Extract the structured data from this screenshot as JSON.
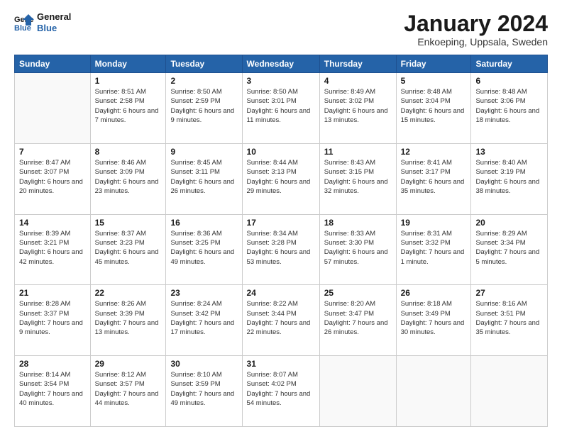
{
  "logo": {
    "line1": "General",
    "line2": "Blue"
  },
  "header": {
    "month_year": "January 2024",
    "location": "Enkoeping, Uppsala, Sweden"
  },
  "days_of_week": [
    "Sunday",
    "Monday",
    "Tuesday",
    "Wednesday",
    "Thursday",
    "Friday",
    "Saturday"
  ],
  "weeks": [
    [
      {
        "day": "",
        "sunrise": "",
        "sunset": "",
        "daylight": "",
        "empty": true
      },
      {
        "day": "1",
        "sunrise": "Sunrise: 8:51 AM",
        "sunset": "Sunset: 2:58 PM",
        "daylight": "Daylight: 6 hours and 7 minutes."
      },
      {
        "day": "2",
        "sunrise": "Sunrise: 8:50 AM",
        "sunset": "Sunset: 2:59 PM",
        "daylight": "Daylight: 6 hours and 9 minutes."
      },
      {
        "day": "3",
        "sunrise": "Sunrise: 8:50 AM",
        "sunset": "Sunset: 3:01 PM",
        "daylight": "Daylight: 6 hours and 11 minutes."
      },
      {
        "day": "4",
        "sunrise": "Sunrise: 8:49 AM",
        "sunset": "Sunset: 3:02 PM",
        "daylight": "Daylight: 6 hours and 13 minutes."
      },
      {
        "day": "5",
        "sunrise": "Sunrise: 8:48 AM",
        "sunset": "Sunset: 3:04 PM",
        "daylight": "Daylight: 6 hours and 15 minutes."
      },
      {
        "day": "6",
        "sunrise": "Sunrise: 8:48 AM",
        "sunset": "Sunset: 3:06 PM",
        "daylight": "Daylight: 6 hours and 18 minutes."
      }
    ],
    [
      {
        "day": "7",
        "sunrise": "Sunrise: 8:47 AM",
        "sunset": "Sunset: 3:07 PM",
        "daylight": "Daylight: 6 hours and 20 minutes."
      },
      {
        "day": "8",
        "sunrise": "Sunrise: 8:46 AM",
        "sunset": "Sunset: 3:09 PM",
        "daylight": "Daylight: 6 hours and 23 minutes."
      },
      {
        "day": "9",
        "sunrise": "Sunrise: 8:45 AM",
        "sunset": "Sunset: 3:11 PM",
        "daylight": "Daylight: 6 hours and 26 minutes."
      },
      {
        "day": "10",
        "sunrise": "Sunrise: 8:44 AM",
        "sunset": "Sunset: 3:13 PM",
        "daylight": "Daylight: 6 hours and 29 minutes."
      },
      {
        "day": "11",
        "sunrise": "Sunrise: 8:43 AM",
        "sunset": "Sunset: 3:15 PM",
        "daylight": "Daylight: 6 hours and 32 minutes."
      },
      {
        "day": "12",
        "sunrise": "Sunrise: 8:41 AM",
        "sunset": "Sunset: 3:17 PM",
        "daylight": "Daylight: 6 hours and 35 minutes."
      },
      {
        "day": "13",
        "sunrise": "Sunrise: 8:40 AM",
        "sunset": "Sunset: 3:19 PM",
        "daylight": "Daylight: 6 hours and 38 minutes."
      }
    ],
    [
      {
        "day": "14",
        "sunrise": "Sunrise: 8:39 AM",
        "sunset": "Sunset: 3:21 PM",
        "daylight": "Daylight: 6 hours and 42 minutes."
      },
      {
        "day": "15",
        "sunrise": "Sunrise: 8:37 AM",
        "sunset": "Sunset: 3:23 PM",
        "daylight": "Daylight: 6 hours and 45 minutes."
      },
      {
        "day": "16",
        "sunrise": "Sunrise: 8:36 AM",
        "sunset": "Sunset: 3:25 PM",
        "daylight": "Daylight: 6 hours and 49 minutes."
      },
      {
        "day": "17",
        "sunrise": "Sunrise: 8:34 AM",
        "sunset": "Sunset: 3:28 PM",
        "daylight": "Daylight: 6 hours and 53 minutes."
      },
      {
        "day": "18",
        "sunrise": "Sunrise: 8:33 AM",
        "sunset": "Sunset: 3:30 PM",
        "daylight": "Daylight: 6 hours and 57 minutes."
      },
      {
        "day": "19",
        "sunrise": "Sunrise: 8:31 AM",
        "sunset": "Sunset: 3:32 PM",
        "daylight": "Daylight: 7 hours and 1 minute."
      },
      {
        "day": "20",
        "sunrise": "Sunrise: 8:29 AM",
        "sunset": "Sunset: 3:34 PM",
        "daylight": "Daylight: 7 hours and 5 minutes."
      }
    ],
    [
      {
        "day": "21",
        "sunrise": "Sunrise: 8:28 AM",
        "sunset": "Sunset: 3:37 PM",
        "daylight": "Daylight: 7 hours and 9 minutes."
      },
      {
        "day": "22",
        "sunrise": "Sunrise: 8:26 AM",
        "sunset": "Sunset: 3:39 PM",
        "daylight": "Daylight: 7 hours and 13 minutes."
      },
      {
        "day": "23",
        "sunrise": "Sunrise: 8:24 AM",
        "sunset": "Sunset: 3:42 PM",
        "daylight": "Daylight: 7 hours and 17 minutes."
      },
      {
        "day": "24",
        "sunrise": "Sunrise: 8:22 AM",
        "sunset": "Sunset: 3:44 PM",
        "daylight": "Daylight: 7 hours and 22 minutes."
      },
      {
        "day": "25",
        "sunrise": "Sunrise: 8:20 AM",
        "sunset": "Sunset: 3:47 PM",
        "daylight": "Daylight: 7 hours and 26 minutes."
      },
      {
        "day": "26",
        "sunrise": "Sunrise: 8:18 AM",
        "sunset": "Sunset: 3:49 PM",
        "daylight": "Daylight: 7 hours and 30 minutes."
      },
      {
        "day": "27",
        "sunrise": "Sunrise: 8:16 AM",
        "sunset": "Sunset: 3:51 PM",
        "daylight": "Daylight: 7 hours and 35 minutes."
      }
    ],
    [
      {
        "day": "28",
        "sunrise": "Sunrise: 8:14 AM",
        "sunset": "Sunset: 3:54 PM",
        "daylight": "Daylight: 7 hours and 40 minutes."
      },
      {
        "day": "29",
        "sunrise": "Sunrise: 8:12 AM",
        "sunset": "Sunset: 3:57 PM",
        "daylight": "Daylight: 7 hours and 44 minutes."
      },
      {
        "day": "30",
        "sunrise": "Sunrise: 8:10 AM",
        "sunset": "Sunset: 3:59 PM",
        "daylight": "Daylight: 7 hours and 49 minutes."
      },
      {
        "day": "31",
        "sunrise": "Sunrise: 8:07 AM",
        "sunset": "Sunset: 4:02 PM",
        "daylight": "Daylight: 7 hours and 54 minutes."
      },
      {
        "day": "",
        "sunrise": "",
        "sunset": "",
        "daylight": "",
        "empty": true
      },
      {
        "day": "",
        "sunrise": "",
        "sunset": "",
        "daylight": "",
        "empty": true
      },
      {
        "day": "",
        "sunrise": "",
        "sunset": "",
        "daylight": "",
        "empty": true
      }
    ]
  ]
}
